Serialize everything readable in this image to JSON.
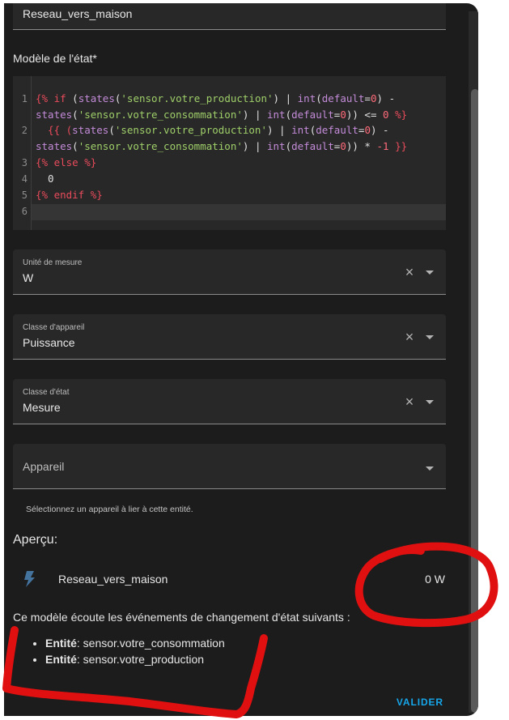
{
  "form": {
    "name_value": "Reseau_vers_maison",
    "template_label": "Modèle de l'état*",
    "code_lines": [
      {
        "num": "1"
      },
      {
        "num": "2"
      },
      {
        "num": "3"
      },
      {
        "num": "4"
      },
      {
        "num": "5"
      },
      {
        "num": "6"
      }
    ],
    "code_tokens": {
      "l1_open": "{% ",
      "l1_if": "if",
      "l1_a": " (",
      "l1_states1": "states",
      "l1_b": "(",
      "l1_s1": "'sensor.votre_production'",
      "l1_c": ") | ",
      "l1_int1": "int",
      "l1_d": "(",
      "l1_default1": "default",
      "l1_e": "=",
      "l1_zero1": "0",
      "l1_f": ") -",
      "l1w_states2": "states",
      "l1w_a": "(",
      "l1w_s2": "'sensor.votre_consommation'",
      "l1w_b": ") | ",
      "l1w_int2": "int",
      "l1w_c": "(",
      "l1w_default2": "default",
      "l1w_d": "=",
      "l1w_zero2": "0",
      "l1w_e": ")) <= ",
      "l1w_zero3": "0",
      "l1w_close": " %}",
      "l2_open": "  {{ (",
      "l2_states1": "states",
      "l2_a": "(",
      "l2_s1": "'sensor.votre_production'",
      "l2_b": ") | ",
      "l2_int1": "int",
      "l2_c": "(",
      "l2_default1": "default",
      "l2_d": "=",
      "l2_zero1": "0",
      "l2_e": ") -",
      "l2w_states2": "states",
      "l2w_a": "(",
      "l2w_s2": "'sensor.votre_consommation'",
      "l2w_b": ") | ",
      "l2w_int2": "int",
      "l2w_c": "(",
      "l2w_default2": "default",
      "l2w_d": "=",
      "l2w_zero2": "0",
      "l2w_e": ")) * ",
      "l2w_neg": "-1",
      "l2w_close": " }}",
      "l3_open": "{% ",
      "l3_else": "else",
      "l3_close": " %}",
      "l4": "  0",
      "l5_open": "{% ",
      "l5_endif": "endif",
      "l5_close": " %}"
    },
    "unit": {
      "label": "Unité de mesure",
      "value": "W"
    },
    "device_class": {
      "label": "Classe d'appareil",
      "value": "Puissance"
    },
    "state_class": {
      "label": "Classe d'état",
      "value": "Mesure"
    },
    "device": {
      "placeholder": "Appareil",
      "helper": "Sélectionnez un appareil à lier à cette entité."
    }
  },
  "preview": {
    "title": "Aperçu:",
    "entity_icon": "flash-icon",
    "entity_name": "Reseau_vers_maison",
    "entity_state": "0 W",
    "listen_intro": "Ce modèle écoute les événements de changement d'état suivants :",
    "listeners": [
      {
        "prefix": "Entité",
        "value": ": sensor.votre_consommation"
      },
      {
        "prefix": "Entité",
        "value": ": sensor.votre_production"
      }
    ]
  },
  "actions": {
    "validate_label": "VALIDER"
  },
  "colors": {
    "dialog_bg": "#1c1c1c",
    "field_bg": "#282828",
    "accent": "#16a6ea",
    "icon": "#44739e",
    "annotation_red": "#e01010"
  }
}
